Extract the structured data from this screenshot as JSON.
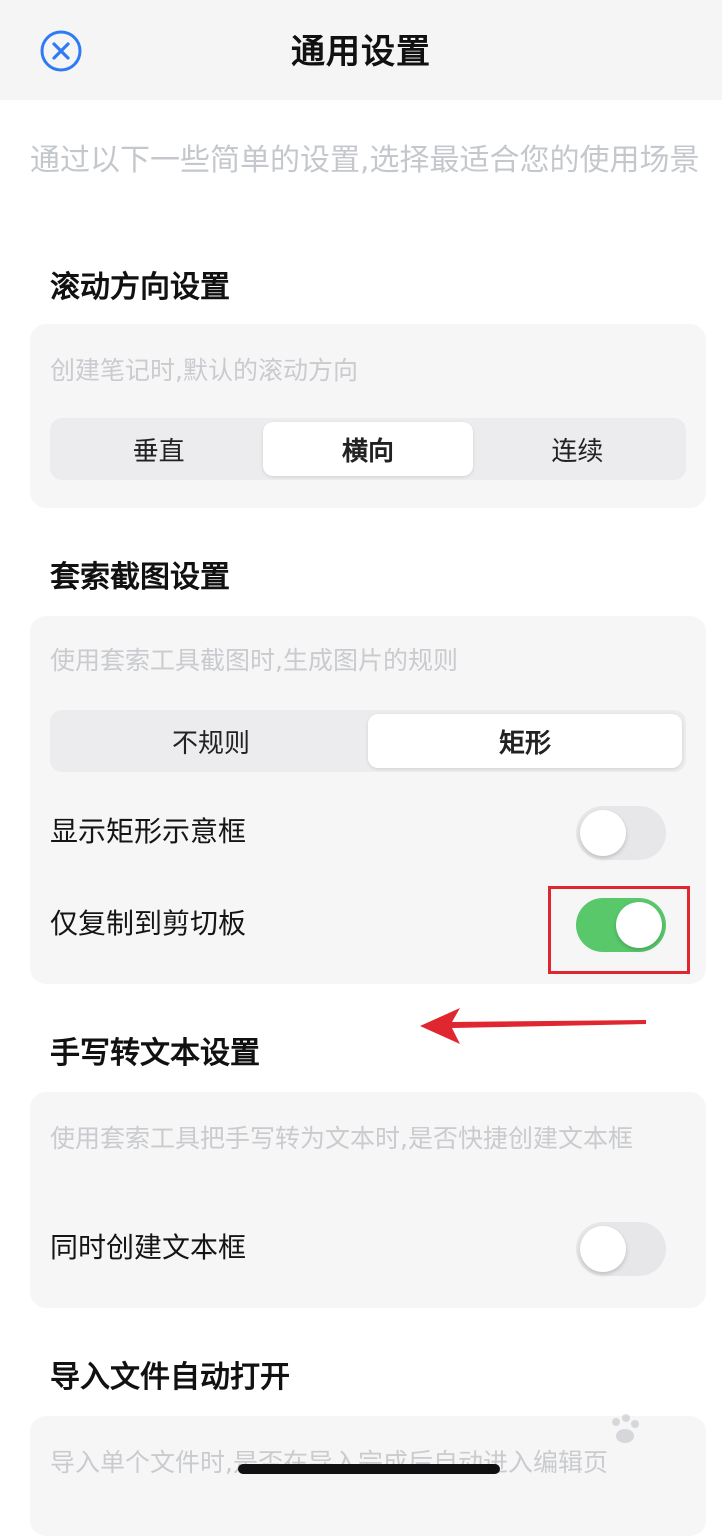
{
  "header": {
    "title": "通用设置",
    "close_icon": "close-circle-icon",
    "accent": "#2f7bf5"
  },
  "intro": "通过以下一些简单的设置,选择最适合您的使用场景",
  "scroll_section": {
    "title": "滚动方向设置",
    "description": "创建笔记时,默认的滚动方向",
    "options": [
      "垂直",
      "横向",
      "连续"
    ],
    "selected": "横向"
  },
  "lasso_section": {
    "title": "套索截图设置",
    "description": "使用套索工具截图时,生成图片的规则",
    "options": [
      "不规则",
      "矩形"
    ],
    "selected": "矩形",
    "toggles": [
      {
        "label": "显示矩形示意框",
        "on": false
      },
      {
        "label": "仅复制到剪切板",
        "on": true
      }
    ]
  },
  "handwriting_section": {
    "title": "手写转文本设置",
    "description": "使用套索工具把手写转为文本时,是否快捷创建文本框",
    "toggle": {
      "label": "同时创建文本框",
      "on": false
    }
  },
  "import_section": {
    "title": "导入文件自动打开",
    "description": "导入单个文件时,是否在导入完成后自动进入编辑页"
  },
  "annotation": {
    "box_color": "#e0262f",
    "arrow_color": "#e0262f"
  },
  "colors": {
    "toggle_on": "#58c86a",
    "toggle_off": "#e7e7e9"
  }
}
